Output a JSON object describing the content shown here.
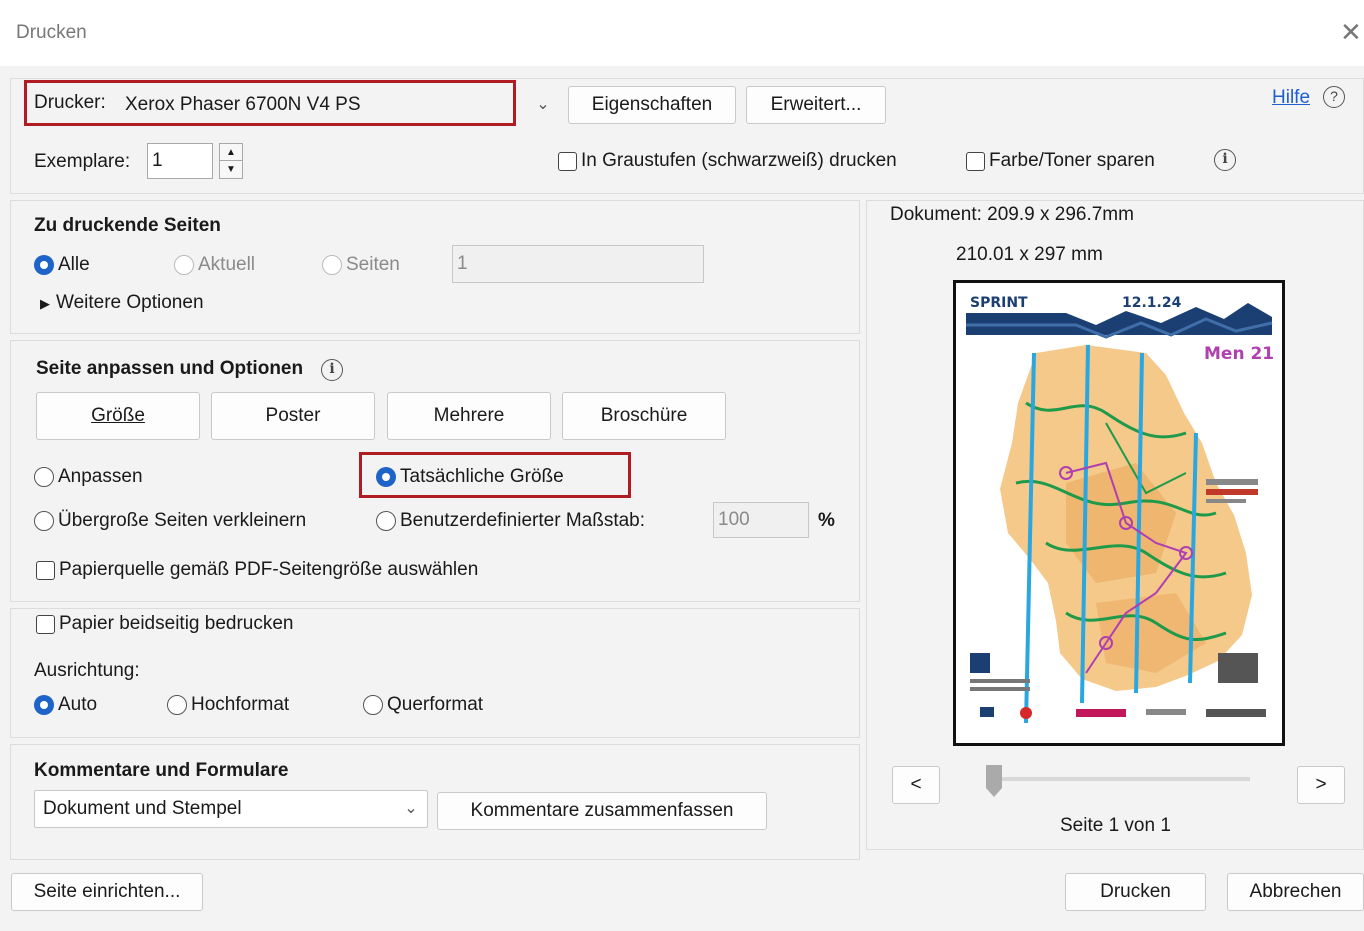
{
  "window": {
    "title": "Drucken"
  },
  "printer": {
    "label": "Drucker:",
    "value": "Xerox Phaser 6700N V4 PS",
    "properties_button": "Eigenschaften",
    "advanced_button": "Erweitert...",
    "help_link": "Hilfe"
  },
  "copies": {
    "label": "Exemplare:",
    "value": "1",
    "grayscale_label": "In Graustufen (schwarzweiß) drucken",
    "save_toner_label": "Farbe/Toner sparen"
  },
  "pages": {
    "heading": "Zu druckende Seiten",
    "all_label": "Alle",
    "current_label": "Aktuell",
    "pages_label": "Seiten",
    "pages_value": "1",
    "more_options": "Weitere Optionen"
  },
  "sizing": {
    "heading": "Seite anpassen und Optionen",
    "tabs": [
      "Größe",
      "Poster",
      "Mehrere",
      "Broschüre"
    ],
    "fit_label": "Anpassen",
    "actual_size_label": "Tatsächliche Größe",
    "shrink_label": "Übergroße Seiten verkleinern",
    "custom_scale_label": "Benutzerdefinierter Maßstab:",
    "custom_scale_value": "100",
    "percent": "%",
    "paper_source_label": "Papierquelle gemäß PDF-Seitengröße auswählen"
  },
  "duplex": {
    "both_sides_label": "Papier beidseitig bedrucken",
    "orientation_label": "Ausrichtung:",
    "auto_label": "Auto",
    "portrait_label": "Hochformat",
    "landscape_label": "Querformat"
  },
  "comments": {
    "heading": "Kommentare und Formulare",
    "select_value": "Dokument und Stempel",
    "summarize_button": "Kommentare zusammenfassen"
  },
  "preview": {
    "document_size": "Dokument: 209.9 x 296.7mm",
    "paper_size": "210.01 x 297 mm",
    "map_header": "SPRINT",
    "map_date": "12.1.24",
    "map_class": "Men 21",
    "prev_button": "<",
    "next_button": ">",
    "page_info": "Seite 1 von 1"
  },
  "footer": {
    "page_setup_button": "Seite einrichten...",
    "print_button": "Drucken",
    "cancel_button": "Abbrechen"
  },
  "colors": {
    "accent": "#1e63c8",
    "highlight_frame": "#b01c24",
    "link": "#1e5fd0"
  }
}
